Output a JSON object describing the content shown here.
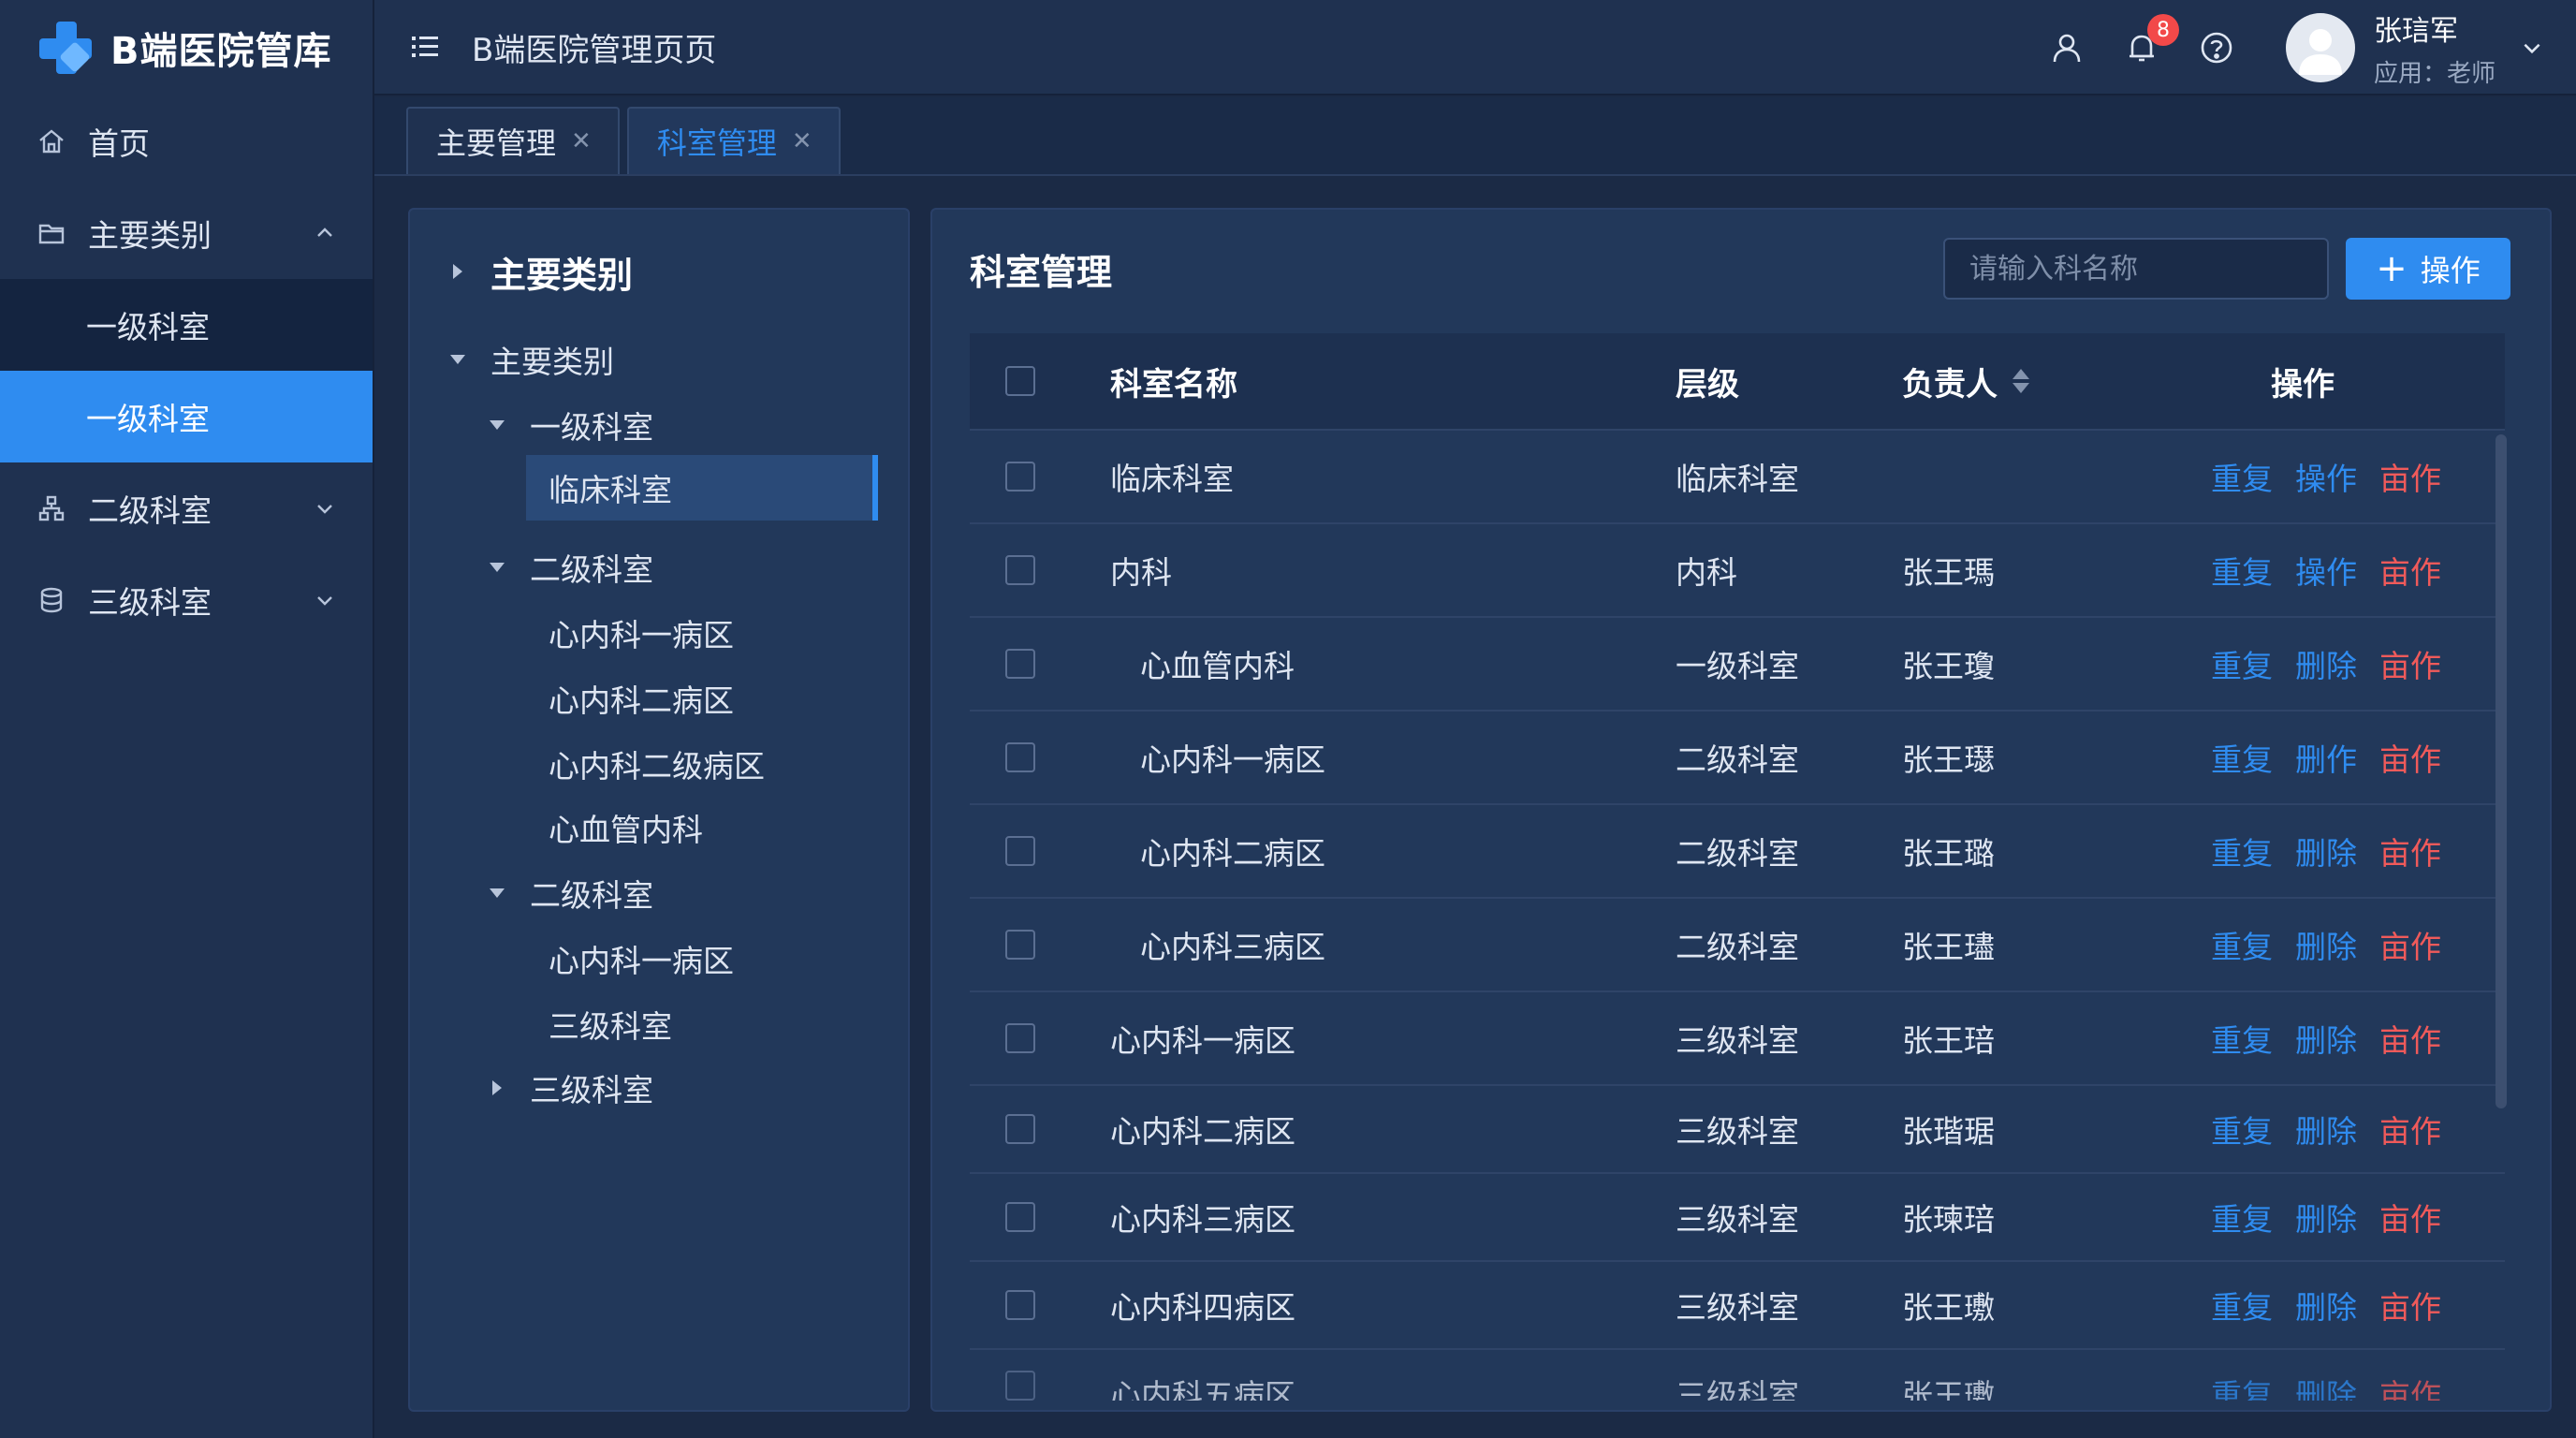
{
  "app": {
    "title": "B端医院管库",
    "page_heading": "B端医院管理页页"
  },
  "sidebar": {
    "items": [
      {
        "label": "首页",
        "icon": "home-icon"
      },
      {
        "label": "主要类别",
        "icon": "folder-icon",
        "expanded": true,
        "children": [
          {
            "label": "一级科室"
          },
          {
            "label": "一级科室",
            "active": true
          }
        ]
      },
      {
        "label": "二级科室",
        "icon": "org-chart-icon"
      },
      {
        "label": "三级科室",
        "icon": "database-icon"
      }
    ]
  },
  "header": {
    "notification_count": "8",
    "user": {
      "name": "张琂军",
      "role": "应用：老师"
    }
  },
  "tabs": [
    {
      "label": "主要管理",
      "active": false
    },
    {
      "label": "科室管理",
      "active": true
    }
  ],
  "tree": {
    "root": "主要类别",
    "nodes": [
      {
        "label": "主要类别",
        "level": 0,
        "expanded": true
      },
      {
        "label": "一级科室",
        "level": 1,
        "expanded": true
      },
      {
        "label": "临床科室",
        "level": 2,
        "selected": true
      },
      {
        "label": "二级科室",
        "level": 1,
        "expanded": true
      },
      {
        "label": "心内科一病区",
        "level": 2
      },
      {
        "label": "心内科二病区",
        "level": 2
      },
      {
        "label": "心内科二级病区",
        "level": 2
      },
      {
        "label": "心血管内科",
        "level": 2
      },
      {
        "label": "二级科室",
        "level": 1,
        "expanded": true
      },
      {
        "label": "心内科一病区",
        "level": 2
      },
      {
        "label": "三级科室",
        "level": 2
      },
      {
        "label": "三级科室",
        "level": 1,
        "expanded": false
      }
    ]
  },
  "main": {
    "title": "科室管理",
    "search_placeholder": "请输入科名称",
    "add_button_label": "操作",
    "columns": {
      "name": "科室名称",
      "level": "层级",
      "owner": "负责人",
      "ops": "操作"
    },
    "rows": [
      {
        "name": "临床科室",
        "level": "临床科室",
        "owner": "",
        "ops": [
          "重复",
          "操作",
          "亩作"
        ],
        "indent": false
      },
      {
        "name": "内科",
        "level": "内科",
        "owner": "张王瑪",
        "ops": [
          "重复",
          "操作",
          "亩作"
        ],
        "indent": false
      },
      {
        "name": "心血管内科",
        "level": "一级科室",
        "owner": "张王瓊",
        "ops": [
          "重复",
          "删除",
          "亩作"
        ],
        "indent": true
      },
      {
        "name": "心内科一病区",
        "level": "二级科室",
        "owner": "张王璱",
        "ops": [
          "重复",
          "删作",
          "亩作"
        ],
        "indent": true
      },
      {
        "name": "心内科二病区",
        "level": "二级科室",
        "owner": "张王璐",
        "ops": [
          "重复",
          "删除",
          "亩作"
        ],
        "indent": true
      },
      {
        "name": "心内科三病区",
        "level": "二级科室",
        "owner": "张王璶",
        "ops": [
          "重复",
          "删除",
          "亩作"
        ],
        "indent": true
      },
      {
        "name": "心内科一病区",
        "level": "三级科室",
        "owner": "张王琣",
        "ops": [
          "重复",
          "删除",
          "亩作"
        ],
        "indent": false
      },
      {
        "name": "心内科二病区",
        "level": "三级科室",
        "owner": "张瑎琚",
        "ops": [
          "重复",
          "删除",
          "亩作"
        ],
        "indent": false
      },
      {
        "name": "心内科三病区",
        "level": "三级科室",
        "owner": "张瑓琣",
        "ops": [
          "重复",
          "删除",
          "亩作"
        ],
        "indent": false
      },
      {
        "name": "心内科四病区",
        "level": "三级科室",
        "owner": "张王璷",
        "ops": [
          "重复",
          "删除",
          "亩作"
        ],
        "indent": false
      },
      {
        "name": "心内科五病区",
        "level": "三级科室",
        "owner": "张王璷",
        "ops": [
          "重复",
          "删除",
          "亩作"
        ],
        "indent": false
      }
    ]
  },
  "colors": {
    "accent": "#2f8cf0",
    "danger": "#f05a5a",
    "sidebar_bg": "#1f3150",
    "page_bg": "#1b2a45"
  }
}
